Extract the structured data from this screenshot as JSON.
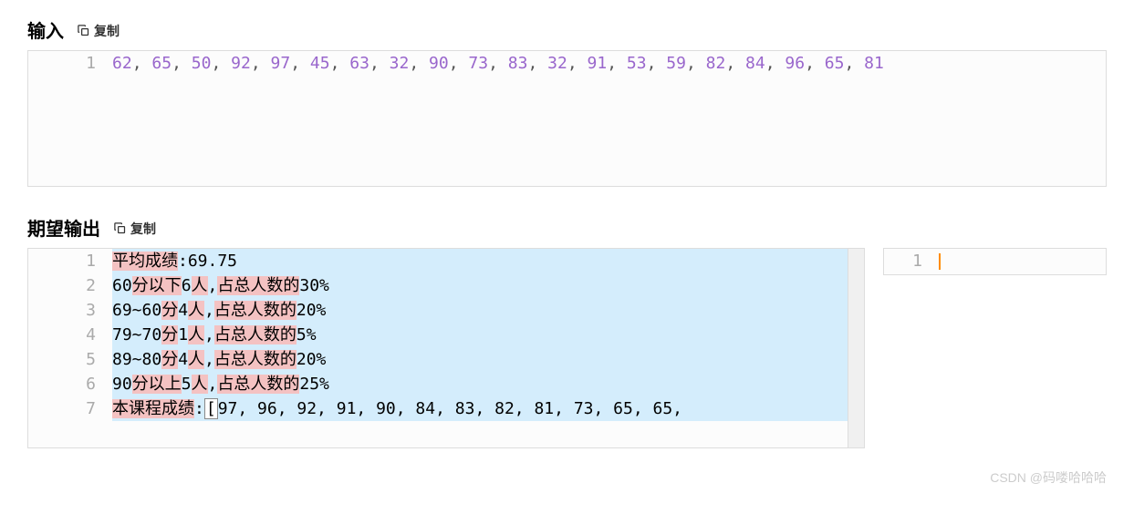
{
  "input": {
    "title": "输入",
    "copy_label": "复制",
    "lines": 1,
    "numbers": [
      62,
      65,
      50,
      92,
      97,
      45,
      63,
      32,
      90,
      73,
      83,
      32,
      91,
      53,
      59,
      82,
      84,
      96,
      65,
      81
    ]
  },
  "expected": {
    "title": "期望输出",
    "copy_label": "复制",
    "lines": [
      {
        "n": 1,
        "segments": [
          {
            "t": "平均成绩",
            "hl": true
          },
          {
            "t": ":69.75"
          }
        ]
      },
      {
        "n": 2,
        "segments": [
          {
            "t": "60"
          },
          {
            "t": "分以下",
            "hl": true
          },
          {
            "t": "6"
          },
          {
            "t": "人",
            "hl": true
          },
          {
            "t": ","
          },
          {
            "t": "占总人数的",
            "hl": true
          },
          {
            "t": "30%"
          }
        ]
      },
      {
        "n": 3,
        "segments": [
          {
            "t": "69~60"
          },
          {
            "t": "分",
            "hl": true
          },
          {
            "t": "4"
          },
          {
            "t": "人",
            "hl": true
          },
          {
            "t": ","
          },
          {
            "t": "占总人数的",
            "hl": true
          },
          {
            "t": "20%"
          }
        ]
      },
      {
        "n": 4,
        "segments": [
          {
            "t": "79~70"
          },
          {
            "t": "分",
            "hl": true
          },
          {
            "t": "1"
          },
          {
            "t": "人",
            "hl": true
          },
          {
            "t": ","
          },
          {
            "t": "占总人数的",
            "hl": true
          },
          {
            "t": "5%"
          }
        ]
      },
      {
        "n": 5,
        "segments": [
          {
            "t": "89~80"
          },
          {
            "t": "分",
            "hl": true
          },
          {
            "t": "4"
          },
          {
            "t": "人",
            "hl": true
          },
          {
            "t": ","
          },
          {
            "t": "占总人数的",
            "hl": true
          },
          {
            "t": "20%"
          }
        ]
      },
      {
        "n": 6,
        "segments": [
          {
            "t": "90"
          },
          {
            "t": "分以上",
            "hl": true
          },
          {
            "t": "5"
          },
          {
            "t": "人",
            "hl": true
          },
          {
            "t": ","
          },
          {
            "t": "占总人数的",
            "hl": true
          },
          {
            "t": "25%"
          }
        ]
      },
      {
        "n": 7,
        "segments": [
          {
            "t": "本课程成绩",
            "hl": true
          },
          {
            "t": ":"
          },
          {
            "t": "[",
            "bracket": true
          },
          {
            "t": "97, 96, 92, 91, 90, 84, 83, 82, 81, 73, 65, 65,"
          }
        ]
      }
    ]
  },
  "right_panel": {
    "line_number": "1"
  },
  "watermark": "CSDN @码喽哈哈哈"
}
